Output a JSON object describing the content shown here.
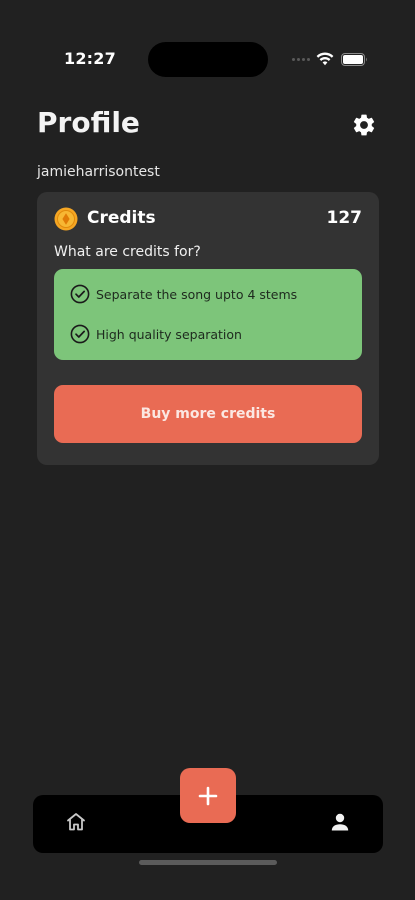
{
  "status_bar": {
    "time": "12:27"
  },
  "header": {
    "title": "Profile",
    "settings_icon": "gear-icon"
  },
  "user": {
    "username": "jamieharrisontest"
  },
  "credits_card": {
    "label": "Credits",
    "count": "127",
    "question": "What are credits for?",
    "benefits": [
      {
        "icon": "check-circle-icon",
        "text": "Separate the song upto 4 stems"
      },
      {
        "icon": "check-circle-icon",
        "text": "High quality separation"
      }
    ],
    "buy_button_label": "Buy more credits"
  },
  "tab_bar": {
    "items": [
      {
        "name": "home",
        "icon": "home-icon"
      },
      {
        "name": "profile",
        "icon": "person-icon"
      }
    ],
    "fab_icon": "plus-icon"
  },
  "colors": {
    "background": "#212121",
    "card": "#333333",
    "accent": "#e96b54",
    "benefits_green": "#7dc57a",
    "coin": "#f5a623"
  }
}
